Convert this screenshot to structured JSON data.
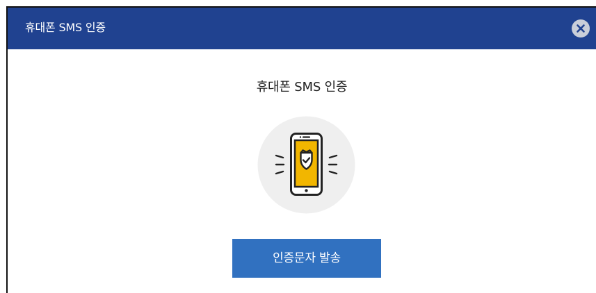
{
  "dialog": {
    "title": "휴대폰 SMS 인증",
    "close_icon": "close-circle-icon",
    "colors": {
      "titlebar": "#204290",
      "button": "#3171c0",
      "phone_screen": "#f2b600"
    }
  },
  "content": {
    "heading": "휴대폰 SMS 인증",
    "illustration_icon": "phone-shield-icon",
    "send_button_label": "인증문자 발송"
  }
}
